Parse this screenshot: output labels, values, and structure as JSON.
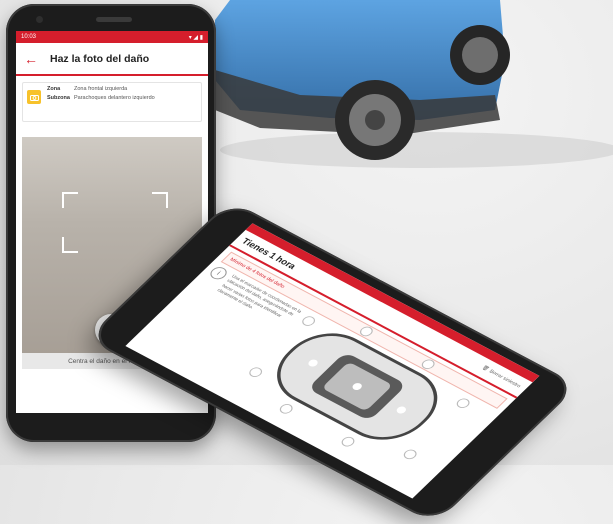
{
  "phone_front": {
    "status_time": "10:03",
    "title": "Haz la foto del daño",
    "zone_label": "Zona",
    "zone_value": "Zona frontal izquierda",
    "subzone_label": "Subzona",
    "subzone_value": "Parachoques delantero izquierdo",
    "hint": "Centra el daño en el recuadro."
  },
  "phone_tilted": {
    "title": "Tienes 1 hora",
    "trash_label": "Borrar siniestro",
    "warning": "Mínimo de 4 fotos del daño",
    "info": "Usa el marcador de coordenadas en la ubicación del daño, asegurándote de hacer varias fotos para identificar claramente el daño."
  },
  "colors": {
    "accent": "#d51e2c",
    "zone_icon": "#f7c22b",
    "car_body": "#2f7fc6"
  },
  "icons": {
    "back": "back-arrow-icon",
    "camera": "camera-icon",
    "flash": "flash-icon",
    "trash": "trash-icon",
    "info": "info-icon"
  }
}
